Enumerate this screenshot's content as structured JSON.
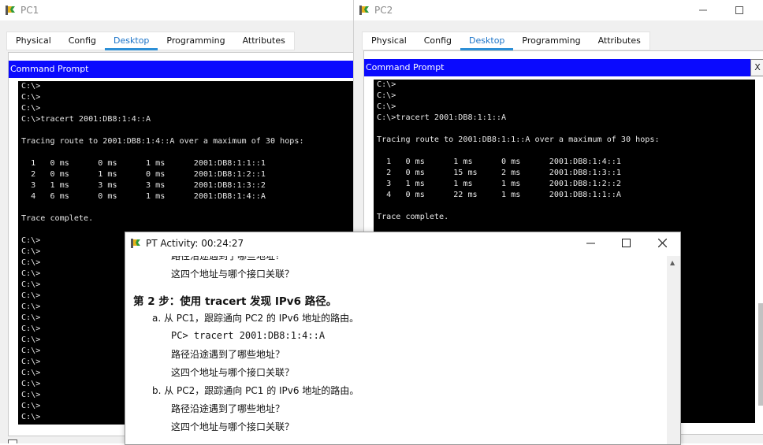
{
  "pc1": {
    "title": "PC1",
    "tabs": [
      "Physical",
      "Config",
      "Desktop",
      "Programming",
      "Attributes"
    ],
    "active_tab": "Desktop",
    "cmd_title": "Command Prompt",
    "console_lines": [
      "C:\\>",
      "C:\\>",
      "C:\\>",
      "C:\\>tracert 2001:DB8:1:4::A",
      "",
      "Tracing route to 2001:DB8:1:4::A over a maximum of 30 hops:",
      "",
      "  1   0 ms      0 ms      1 ms      2001:DB8:1:1::1",
      "  2   0 ms      1 ms      0 ms      2001:DB8:1:2::1",
      "  3   1 ms      3 ms      3 ms      2001:DB8:1:3::2",
      "  4   6 ms      0 ms      1 ms      2001:DB8:1:4::A",
      "",
      "Trace complete.",
      "",
      "C:\\>",
      "C:\\>",
      "C:\\>",
      "C:\\>",
      "C:\\>",
      "C:\\>",
      "C:\\>",
      "C:\\>",
      "C:\\>",
      "C:\\>",
      "C:\\>",
      "C:\\>",
      "C:\\>",
      "C:\\>",
      "C:\\>",
      "C:\\>",
      "C:\\>"
    ]
  },
  "pc2": {
    "title": "PC2",
    "tabs": [
      "Physical",
      "Config",
      "Desktop",
      "Programming",
      "Attributes"
    ],
    "active_tab": "Desktop",
    "cmd_title": "Command Prompt",
    "close_label": "X",
    "console_lines": [
      "C:\\>",
      "C:\\>",
      "C:\\>",
      "C:\\>tracert 2001:DB8:1:1::A",
      "",
      "Tracing route to 2001:DB8:1:1::A over a maximum of 30 hops:",
      "",
      "  1   0 ms      1 ms      0 ms      2001:DB8:1:4::1",
      "  2   0 ms      15 ms     2 ms      2001:DB8:1:3::1",
      "  3   1 ms      1 ms      1 ms      2001:DB8:1:2::2",
      "  4   0 ms      22 ms     1 ms      2001:DB8:1:1::A",
      "",
      "Trace complete."
    ]
  },
  "activity": {
    "title": "PT Activity: 00:24:27",
    "lines": [
      {
        "text": "路径沿途遇到了哪些地址？",
        "kind": "cut"
      },
      {
        "text": "这四个地址与哪个接口关联？",
        "kind": "normal"
      },
      {
        "text": "第 2 步：使用 tracert 发现 IPv6 路径。",
        "kind": "heading"
      },
      {
        "text": "a.  从 PC1，跟踪通向 PC2 的 IPv6 地址的路由。",
        "kind": "item"
      },
      {
        "text": "PC> tracert 2001:DB8:1:4::A",
        "kind": "code"
      },
      {
        "text": "路径沿途遇到了哪些地址？",
        "kind": "normal"
      },
      {
        "text": "这四个地址与哪个接口关联？",
        "kind": "normal"
      },
      {
        "text": "b.  从 PC2，跟踪通向 PC1 的 IPv6 地址的路由。",
        "kind": "item"
      },
      {
        "text": "路径沿途遇到了哪些地址？",
        "kind": "normal"
      },
      {
        "text": "这四个地址与哪个接口关联？",
        "kind": "normal"
      }
    ]
  }
}
